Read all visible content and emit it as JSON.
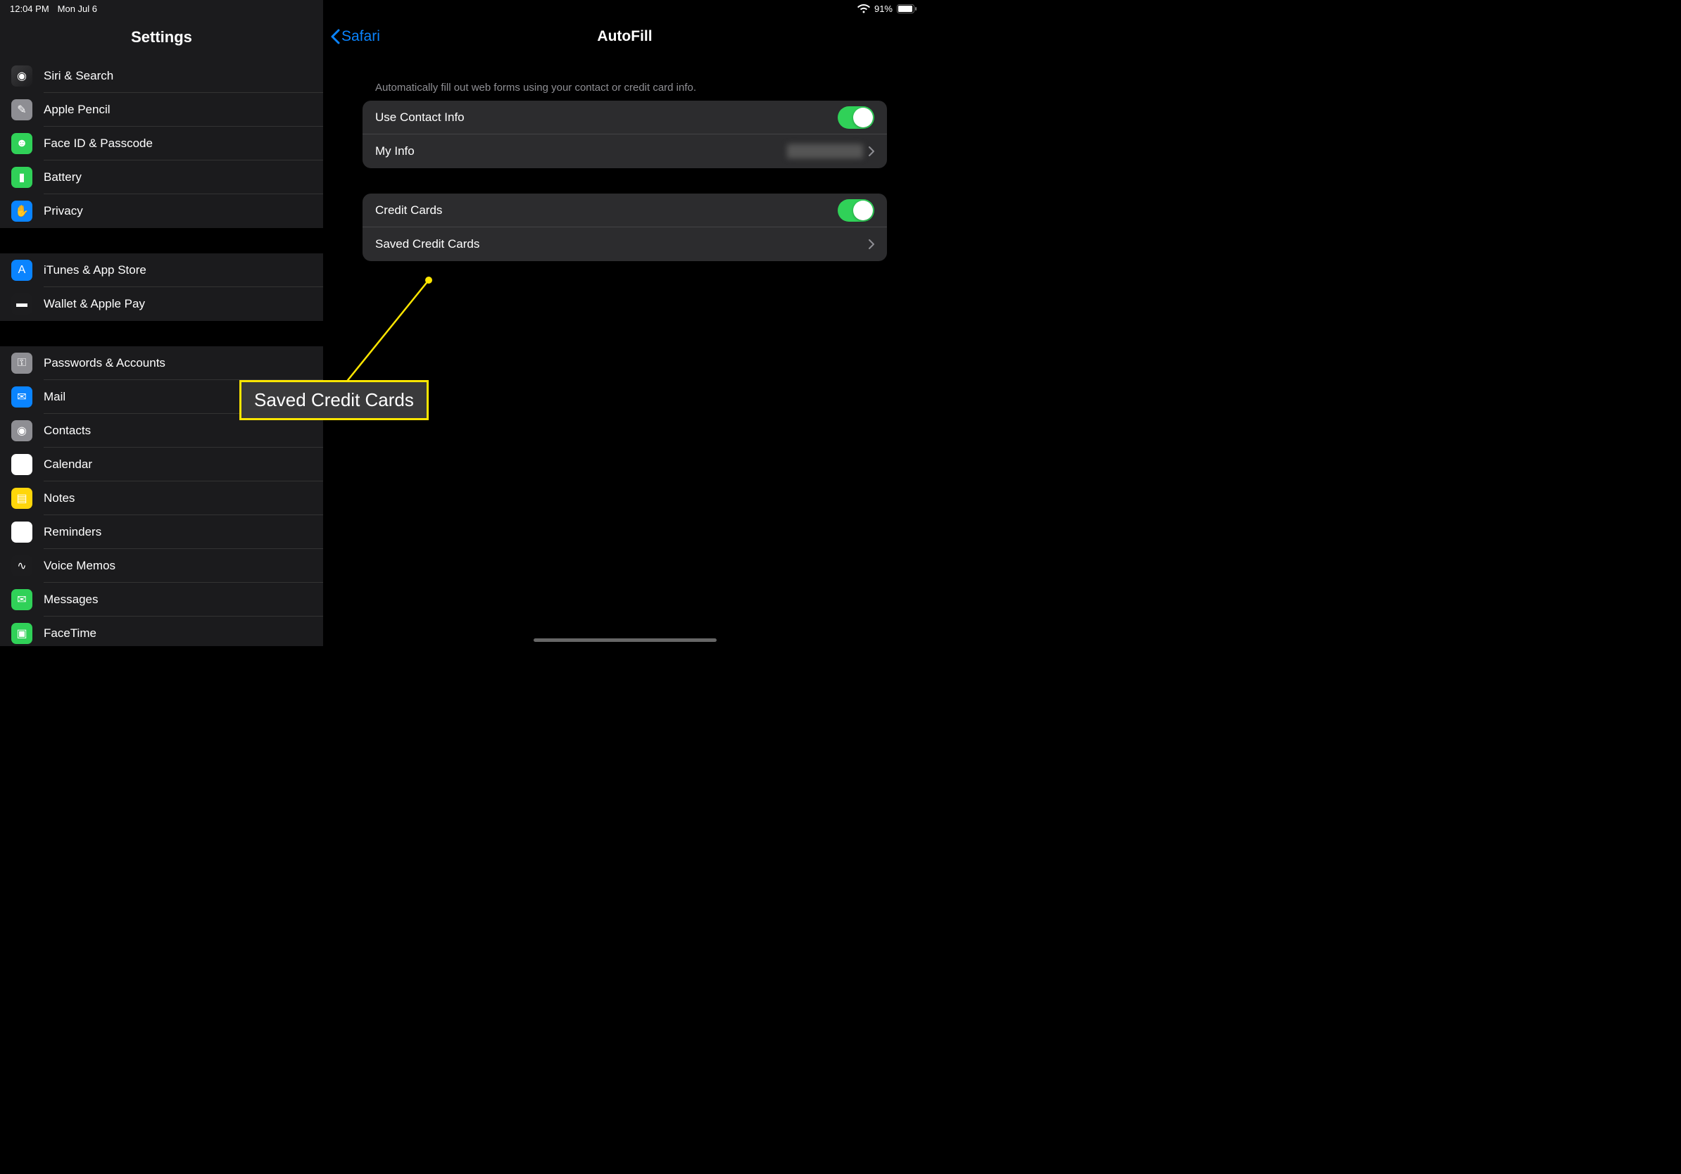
{
  "status": {
    "time": "12:04 PM",
    "date": "Mon Jul 6",
    "battery_pct": "91%"
  },
  "sidebar": {
    "title": "Settings",
    "groups": [
      [
        {
          "label": "Siri & Search",
          "icon_bg": "linear-gradient(135deg,#3a3a3c,#1c1c1e)",
          "glyph": "◉",
          "name": "sidebar-item-siri"
        },
        {
          "label": "Apple Pencil",
          "icon_bg": "#8e8e93",
          "glyph": "✎",
          "name": "sidebar-item-pencil"
        },
        {
          "label": "Face ID & Passcode",
          "icon_bg": "#30d158",
          "glyph": "☻",
          "name": "sidebar-item-faceid"
        },
        {
          "label": "Battery",
          "icon_bg": "#30d158",
          "glyph": "▮",
          "name": "sidebar-item-battery"
        },
        {
          "label": "Privacy",
          "icon_bg": "#0a84ff",
          "glyph": "✋",
          "name": "sidebar-item-privacy"
        }
      ],
      [
        {
          "label": "iTunes & App Store",
          "icon_bg": "#0a84ff",
          "glyph": "A",
          "name": "sidebar-item-appstore"
        },
        {
          "label": "Wallet & Apple Pay",
          "icon_bg": "#1c1c1e",
          "glyph": "▬",
          "name": "sidebar-item-wallet"
        }
      ],
      [
        {
          "label": "Passwords & Accounts",
          "icon_bg": "#8e8e93",
          "glyph": "⚿",
          "name": "sidebar-item-passwords"
        },
        {
          "label": "Mail",
          "icon_bg": "#0a84ff",
          "glyph": "✉",
          "name": "sidebar-item-mail"
        },
        {
          "label": "Contacts",
          "icon_bg": "#8e8e93",
          "glyph": "◉",
          "name": "sidebar-item-contacts"
        },
        {
          "label": "Calendar",
          "icon_bg": "#fff",
          "glyph": "▦",
          "name": "sidebar-item-calendar"
        },
        {
          "label": "Notes",
          "icon_bg": "#ffd60a",
          "glyph": "▤",
          "name": "sidebar-item-notes"
        },
        {
          "label": "Reminders",
          "icon_bg": "#fff",
          "glyph": "⋮",
          "name": "sidebar-item-reminders"
        },
        {
          "label": "Voice Memos",
          "icon_bg": "#1c1c1e",
          "glyph": "∿",
          "name": "sidebar-item-voicememos"
        },
        {
          "label": "Messages",
          "icon_bg": "#30d158",
          "glyph": "✉",
          "name": "sidebar-item-messages"
        },
        {
          "label": "FaceTime",
          "icon_bg": "#30d158",
          "glyph": "▣",
          "name": "sidebar-item-facetime"
        }
      ]
    ]
  },
  "detail": {
    "back_label": "Safari",
    "title": "AutoFill",
    "caption": "Automatically fill out web forms using your contact or credit card info.",
    "section1": {
      "row0_label": "Use Contact Info",
      "row1_label": "My Info",
      "row1_value": "████████"
    },
    "section2": {
      "row0_label": "Credit Cards",
      "row1_label": "Saved Credit Cards"
    }
  },
  "callout": {
    "text": "Saved Credit Cards"
  }
}
